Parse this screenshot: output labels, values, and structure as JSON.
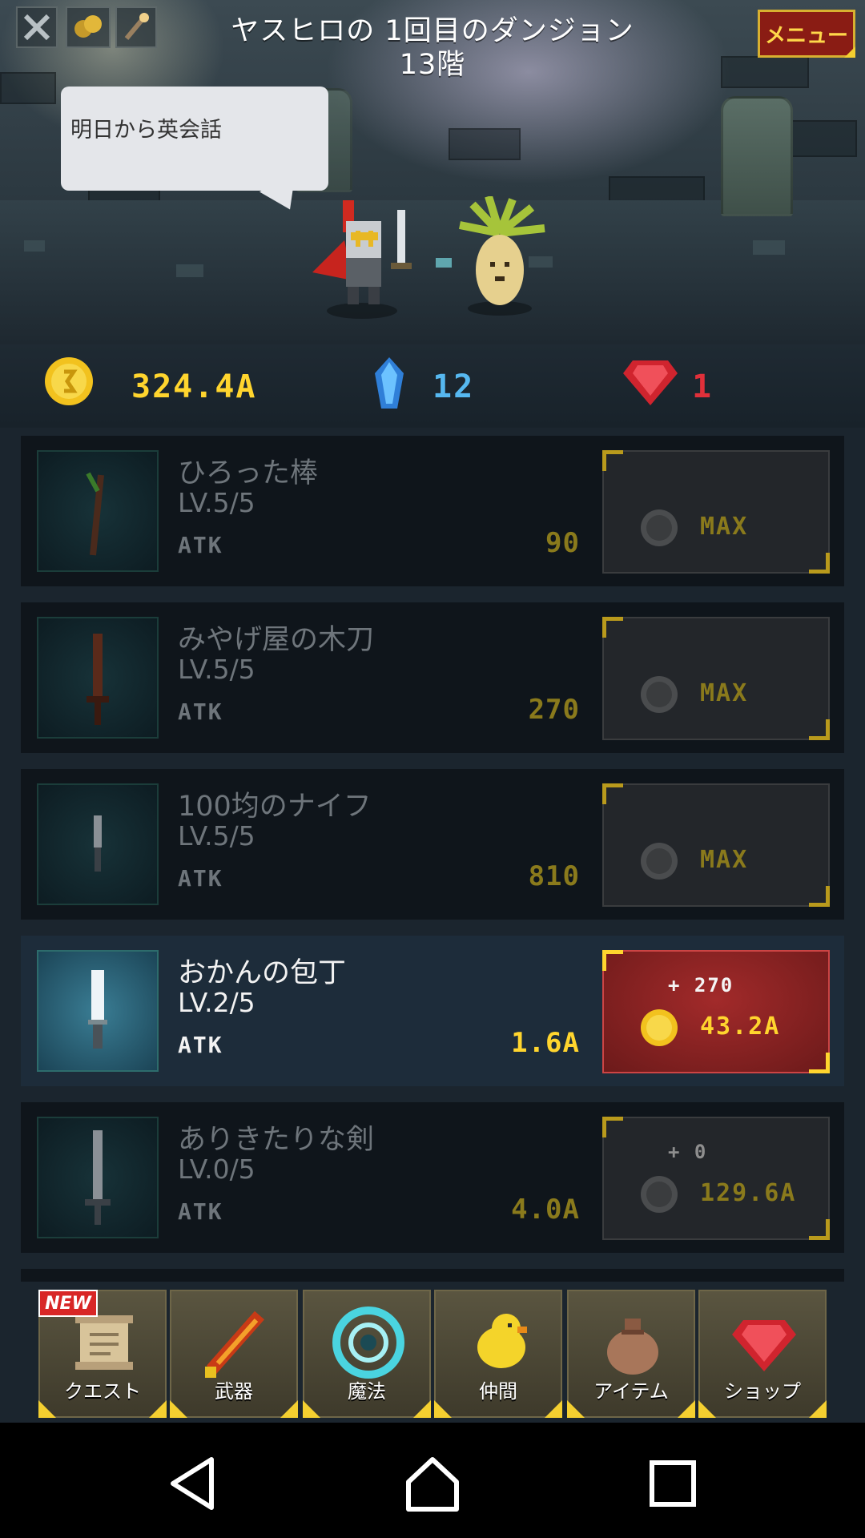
{
  "header": {
    "title": "ヤスヒロの 1回目のダンジョン",
    "floor": "13階",
    "menu_label": "メニュー"
  },
  "speech_bubble": "明日から英会話",
  "currency": {
    "gold": "324.4A",
    "crystals": "12",
    "gems": "1"
  },
  "weapons": [
    {
      "name": "ひろった棒",
      "level": "LV.5/5",
      "atk_label": "ATK",
      "atk": "90",
      "button_label": "MAX",
      "bonus": ""
    },
    {
      "name": "みやげ屋の木刀",
      "level": "LV.5/5",
      "atk_label": "ATK",
      "atk": "270",
      "button_label": "MAX",
      "bonus": ""
    },
    {
      "name": "100均のナイフ",
      "level": "LV.5/5",
      "atk_label": "ATK",
      "atk": "810",
      "button_label": "MAX",
      "bonus": ""
    },
    {
      "name": "おかんの包丁",
      "level": "LV.2/5",
      "atk_label": "ATK",
      "atk": "1.6A",
      "button_label": "43.2A",
      "bonus": "+ 270"
    },
    {
      "name": "ありきたりな剣",
      "level": "LV.0/5",
      "atk_label": "ATK",
      "atk": "4.0A",
      "button_label": "129.6A",
      "bonus": "+ 0"
    }
  ],
  "tabs": [
    {
      "label": "クエスト",
      "icon": "scroll-icon",
      "badge": "NEW"
    },
    {
      "label": "武器",
      "icon": "flame-sword-icon"
    },
    {
      "label": "魔法",
      "icon": "magic-ring-icon"
    },
    {
      "label": "仲間",
      "icon": "chick-icon"
    },
    {
      "label": "アイテム",
      "icon": "bag-icon"
    },
    {
      "label": "ショップ",
      "icon": "ruby-icon"
    }
  ],
  "colors": {
    "gold": "#ffd52e",
    "crystal": "#56b8f0",
    "gem": "#e0303a",
    "active_button": "#8a1c1c"
  }
}
